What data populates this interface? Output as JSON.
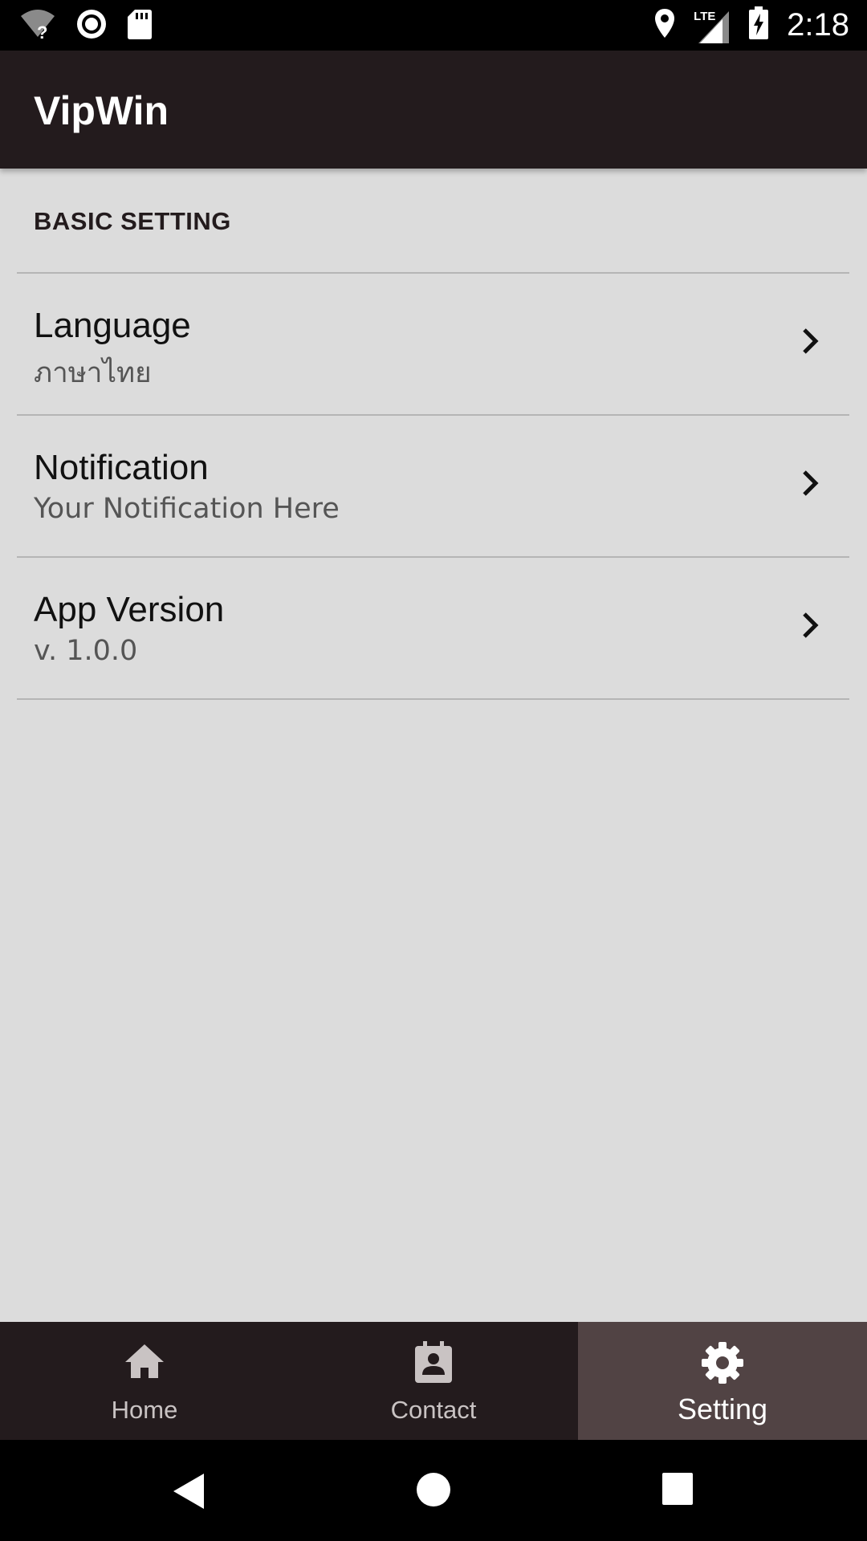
{
  "status_bar": {
    "time": "2:18",
    "network_label": "LTE",
    "icons": [
      "wifi-unknown-icon",
      "record-icon",
      "sd-card-icon",
      "location-icon",
      "signal-icon",
      "battery-charging-icon"
    ]
  },
  "app_bar": {
    "title": "VipWin"
  },
  "settings": {
    "section_title": "BASIC SETTING",
    "items": [
      {
        "title": "Language",
        "subtitle": "ภาษาไทย",
        "icon": "chevron-right-icon"
      },
      {
        "title": "Notification",
        "subtitle": "Your Notification Here",
        "icon": "chevron-right-icon"
      },
      {
        "title": "App Version",
        "subtitle": "v. 1.0.0",
        "icon": "chevron-right-icon"
      }
    ]
  },
  "bottom_nav": {
    "items": [
      {
        "label": "Home",
        "icon": "home-icon",
        "active": false
      },
      {
        "label": "Contact",
        "icon": "contact-icon",
        "active": false
      },
      {
        "label": "Setting",
        "icon": "gear-icon",
        "active": true
      }
    ]
  },
  "colors": {
    "app_bar": "#231b1d",
    "background": "#dcdcdc",
    "active_tab": "#514344"
  }
}
